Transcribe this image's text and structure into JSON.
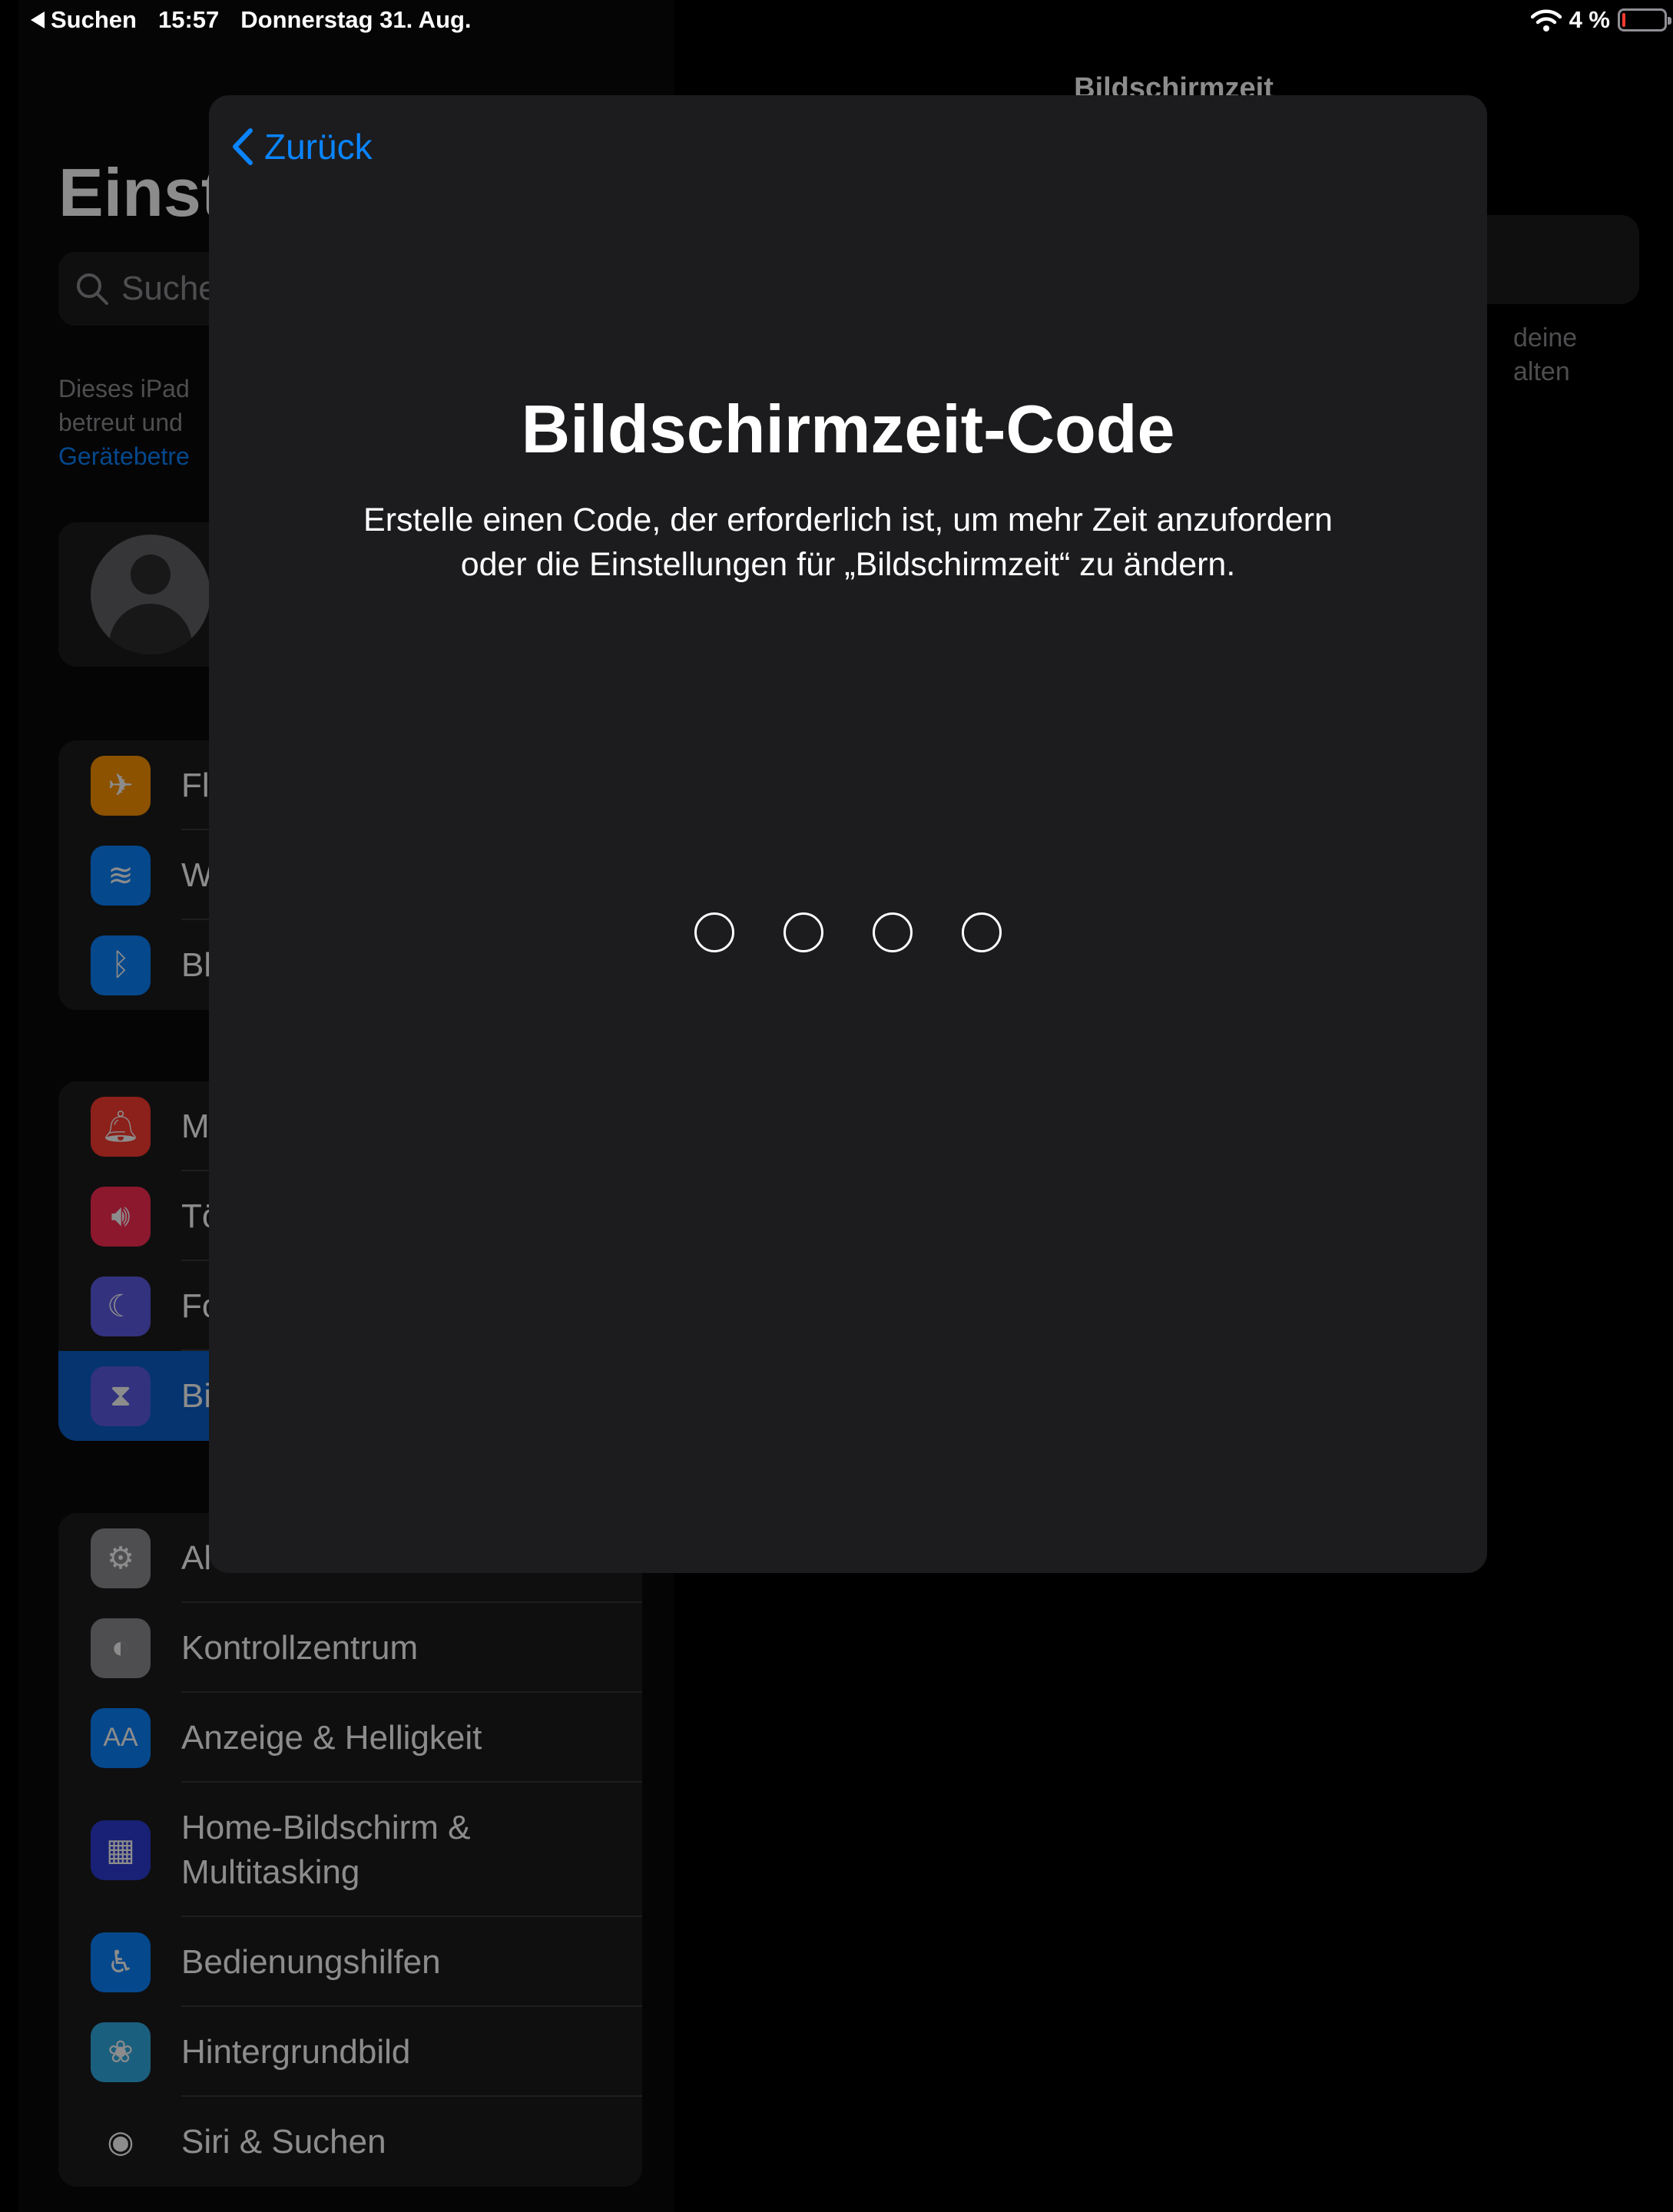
{
  "status_bar": {
    "back_label": "Suchen",
    "time": "15:57",
    "date": "Donnerstag 31. Aug.",
    "battery_text": "4 %",
    "battery_level_percent": 4
  },
  "sidebar": {
    "title": "Einst",
    "search_placeholder": "Suche",
    "notice_line1": "Dieses iPad",
    "notice_line2": "betreut und",
    "notice_link": "Gerätebetre",
    "groups": [
      {
        "items": [
          {
            "label": "Fl",
            "icon": "airplane-icon",
            "color": "#ff9500"
          },
          {
            "label": "W",
            "icon": "wifi-icon",
            "color": "#0a84ff"
          },
          {
            "label": "Bl",
            "icon": "bluetooth-icon",
            "color": "#0a84ff"
          }
        ]
      },
      {
        "items": [
          {
            "label": "M",
            "icon": "bell-icon",
            "color": "#ff3b30"
          },
          {
            "label": "Tö",
            "icon": "speaker-icon",
            "color": "#ff2d55"
          },
          {
            "label": "Fo",
            "icon": "moon-icon",
            "color": "#5e5ce6"
          },
          {
            "label": "Bi",
            "icon": "hourglass-icon",
            "color": "#5e5ce6",
            "selected": true
          }
        ]
      },
      {
        "items": [
          {
            "label": "Al",
            "icon": "gear-icon",
            "color": "#8e8e93"
          },
          {
            "label": "Kontrollzentrum",
            "icon": "toggles-icon",
            "color": "#8e8e93"
          },
          {
            "label": "Anzeige & Helligkeit",
            "icon": "text-size-icon",
            "color": "#0a84ff"
          },
          {
            "label": "Home-Bildschirm & Multitasking",
            "icon": "home-grid-icon",
            "color": "#2c3cd6"
          },
          {
            "label": "Bedienungshilfen",
            "icon": "accessibility-icon",
            "color": "#0a84ff"
          },
          {
            "label": "Hintergrundbild",
            "icon": "flower-icon",
            "color": "#32ade6"
          },
          {
            "label": "Siri & Suchen",
            "icon": "siri-icon",
            "color": "#1c1c1e"
          }
        ]
      }
    ]
  },
  "detail": {
    "title": "Bildschirmzeit",
    "text_line1": "deine",
    "text_line2": "alten"
  },
  "modal": {
    "back_label": "Zurück",
    "title": "Bildschirmzeit-Code",
    "description_line1": "Erstelle einen Code, der erforderlich ist, um mehr Zeit anzufordern",
    "description_line2": "oder die Einstellungen für „Bildschirmzeit“ zu ändern.",
    "code_length": 4
  }
}
